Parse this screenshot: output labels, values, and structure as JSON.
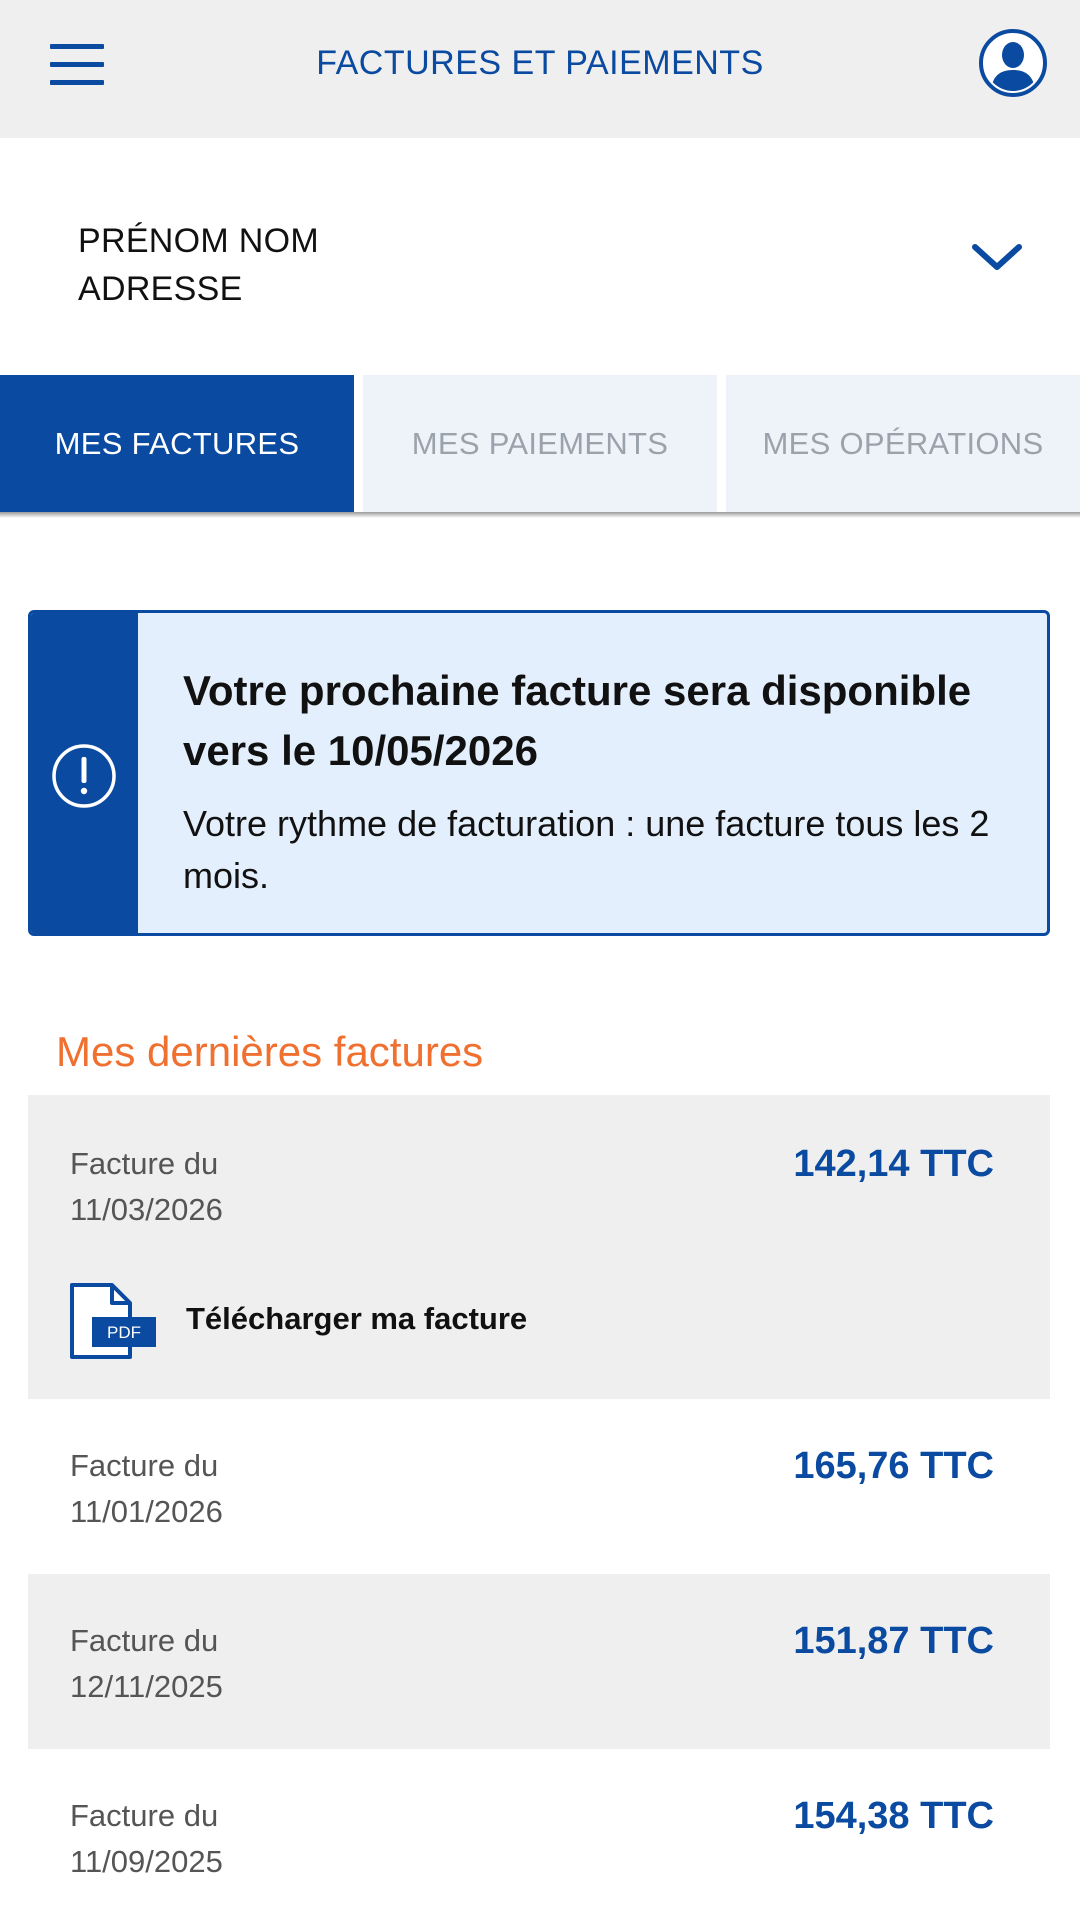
{
  "header": {
    "title": "FACTURES ET PAIEMENTS",
    "menu_icon": "hamburger-menu-icon",
    "profile_icon": "user-avatar-icon"
  },
  "account": {
    "name": "PRÉNOM NOM",
    "address": "ADRESSE",
    "expand_icon": "chevron-down-icon"
  },
  "tabs": [
    {
      "label": "MES FACTURES",
      "active": true
    },
    {
      "label": "MES PAIEMENTS",
      "active": false
    },
    {
      "label": "MES OPÉRATIONS",
      "active": false
    }
  ],
  "banner": {
    "icon": "exclamation-circle-icon",
    "title": "Votre prochaine facture sera disponible vers le 10/05/2026",
    "text": "Votre rythme de facturation : une facture tous les 2 mois."
  },
  "invoices_section": {
    "title": "Mes dernières factures",
    "download_label": "Télécharger ma facture",
    "items": [
      {
        "label": "Facture du",
        "date": "11/03/2026",
        "amount": "142,14 TTC"
      },
      {
        "label": "Facture du",
        "date": "11/01/2026",
        "amount": "165,76 TTC"
      },
      {
        "label": "Facture du",
        "date": "12/11/2025",
        "amount": "151,87 TTC"
      },
      {
        "label": "Facture du",
        "date": "11/09/2025",
        "amount": "154,38 TTC"
      }
    ]
  },
  "colors": {
    "primary": "#0a4aa0",
    "accent": "#f07030",
    "banner_bg": "#e3effc"
  }
}
